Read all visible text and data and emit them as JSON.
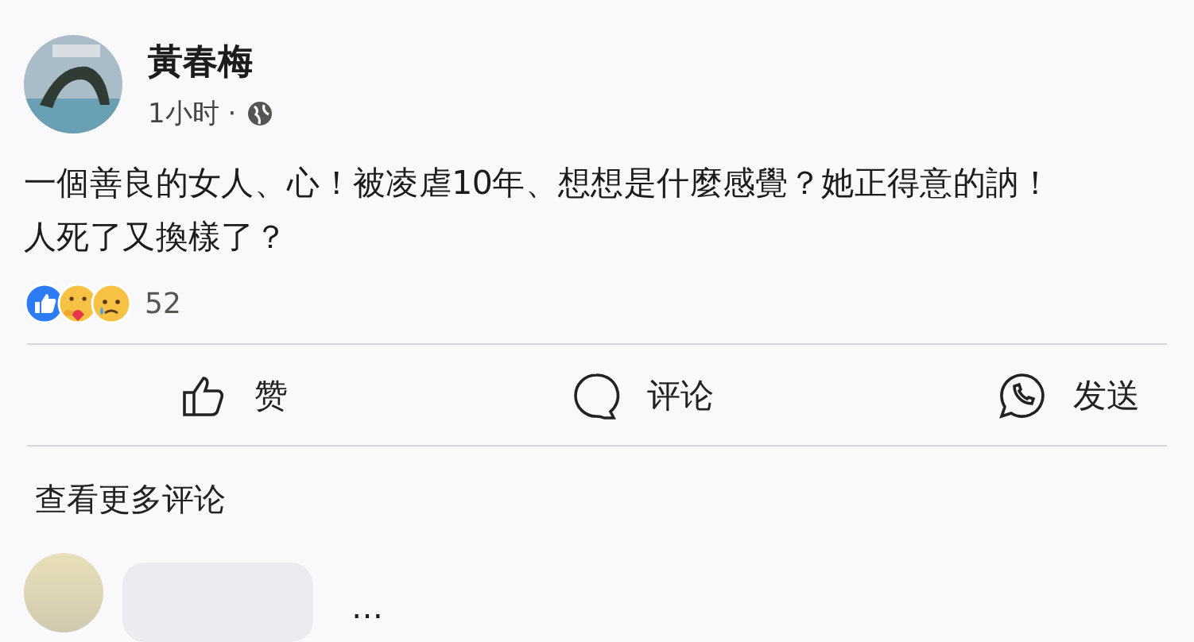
{
  "post": {
    "author": "黃春梅",
    "time": "1小时 ·",
    "text_lines": [
      "一個善良的女人、心！被凌虐10年、想想是什麼感覺？她正得意的訥！",
      "人死了又換樣了？"
    ],
    "reactions": [
      {
        "kind": "like"
      },
      {
        "kind": "care"
      },
      {
        "kind": "sad"
      }
    ],
    "reaction_count": "52"
  },
  "actions": [
    {
      "kind": "like",
      "label": "赞"
    },
    {
      "kind": "comment",
      "label": "评论"
    },
    {
      "kind": "send",
      "label": "发送"
    }
  ],
  "more_comments": "查看更多评论",
  "comment": {
    "more": "…"
  }
}
